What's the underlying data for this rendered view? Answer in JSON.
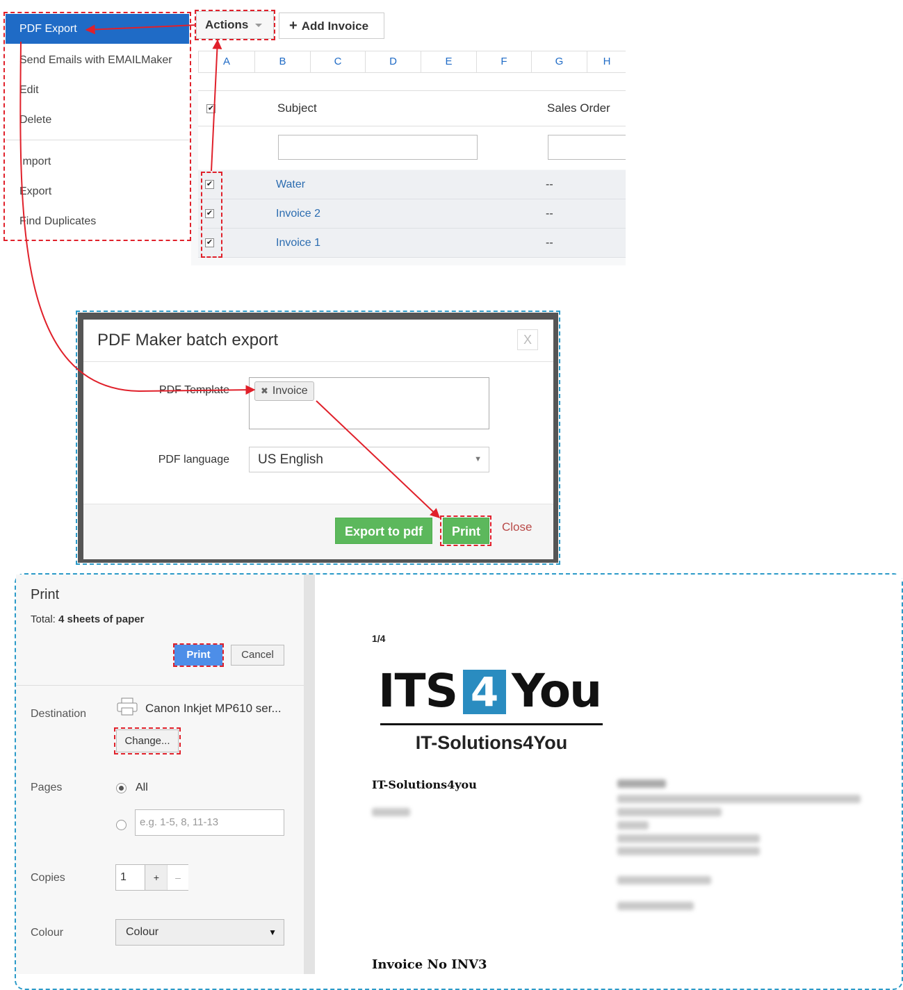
{
  "actions_menu": {
    "items": [
      {
        "label": "PDF Export",
        "active": true
      },
      {
        "label": "Send Emails with EMAILMaker"
      },
      {
        "label": "Edit"
      },
      {
        "label": "Delete"
      },
      {
        "label": "Import"
      },
      {
        "label": "Export"
      },
      {
        "label": "Find Duplicates"
      }
    ]
  },
  "toolbar": {
    "actions_label": "Actions",
    "add_invoice_label": "Add Invoice",
    "add_icon": "plus-icon"
  },
  "column_letters": [
    "A",
    "B",
    "C",
    "D",
    "E",
    "F",
    "G",
    "H"
  ],
  "grid": {
    "headers": {
      "subject": "Subject",
      "sales_order": "Sales Order"
    },
    "rows": [
      {
        "subject": "Water",
        "sales_order": "--",
        "checked": true
      },
      {
        "subject": "Invoice 2",
        "sales_order": "--",
        "checked": true
      },
      {
        "subject": "Invoice 1",
        "sales_order": "--",
        "checked": true
      }
    ]
  },
  "modal": {
    "title": "PDF Maker batch export",
    "close_glyph": "X",
    "template_label": "PDF Template",
    "template_tag": "Invoice",
    "language_label": "PDF language",
    "language_value": "US English",
    "export_button": "Export to pdf",
    "print_button": "Print",
    "close_link": "Close"
  },
  "print_dialog": {
    "title": "Print",
    "total_label": "Total:",
    "total_value": "4 sheets of paper",
    "print_button": "Print",
    "cancel_button": "Cancel",
    "destination_label": "Destination",
    "destination_value": "Canon Inkjet MP610 ser...",
    "change_button": "Change...",
    "pages_label": "Pages",
    "pages_all": "All",
    "pages_placeholder": "e.g. 1-5, 8, 11-13",
    "copies_label": "Copies",
    "copies_value": "1",
    "copies_plus": "+",
    "copies_minus": "–",
    "colour_label": "Colour",
    "colour_value": "Colour"
  },
  "preview": {
    "page_counter": "1/4",
    "logo_text_left": "ITS",
    "logo_text_num": "4",
    "logo_text_right": "You",
    "logo_subtitle": "IT-Solutions4You",
    "company_name": "IT-Solutions4you",
    "invoice_title": "Invoice No INV3"
  },
  "colors": {
    "accent_blue": "#1f6bc6",
    "annotation_red": "#e0202a",
    "annotation_blue": "#2b9ac8",
    "green_button": "#5cb85c",
    "print_blue": "#4d8ee8",
    "logo_teal": "#2a8cc0"
  }
}
